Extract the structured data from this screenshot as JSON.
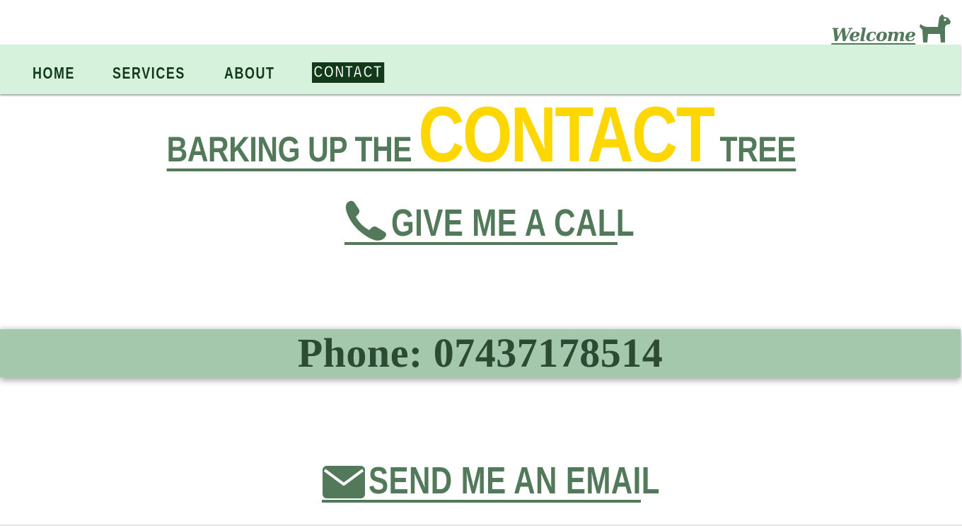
{
  "header": {
    "welcome_label": "Welcome",
    "welcome_icon": "dog-icon"
  },
  "nav": {
    "items": [
      {
        "label": "HOME"
      },
      {
        "label": "SERVICES"
      },
      {
        "label": "ABOUT"
      },
      {
        "label": "CONTACT",
        "active": true
      }
    ]
  },
  "main": {
    "headline_before": "BARKING UP THE",
    "headline_highlight": "CONTACT",
    "headline_after": "TREE",
    "call_label": " GIVE ME A CALL",
    "call_icon": "phone-icon",
    "phone_text": "Phone: 07437178514",
    "email_label": " SEND ME AN EMAIL",
    "email_icon": "envelope-icon"
  },
  "colors": {
    "accent_green": "#527a5a",
    "nav_bg": "#d6f1dc",
    "phone_band_bg": "#a3c8ac",
    "highlight_yellow": "#ffd700",
    "nav_text": "#123a1a"
  }
}
